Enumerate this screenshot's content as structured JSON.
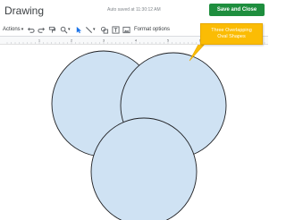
{
  "app": {
    "title": "Drawing",
    "autosave_text": "Auto saved at 11:30:12 AM"
  },
  "header": {
    "save_close_label": "Save and Close"
  },
  "toolbar": {
    "actions_label": "Actions",
    "format_options_label": "Format options"
  },
  "ruler": {
    "ticks": [
      "1",
      "2",
      "3",
      "4",
      "5",
      "6",
      "7"
    ]
  },
  "annotation": {
    "line1": "Three Overlapping",
    "line2": "Oval Shapes"
  },
  "colors": {
    "accent": "#1e8e3e",
    "shape_fill": "#cfe2f3",
    "callout": "#fbbc04"
  },
  "icons": [
    "undo-icon",
    "redo-icon",
    "paint-format-icon",
    "zoom-icon",
    "select-icon",
    "line-icon",
    "shape-icon",
    "textbox-icon",
    "image-icon"
  ]
}
